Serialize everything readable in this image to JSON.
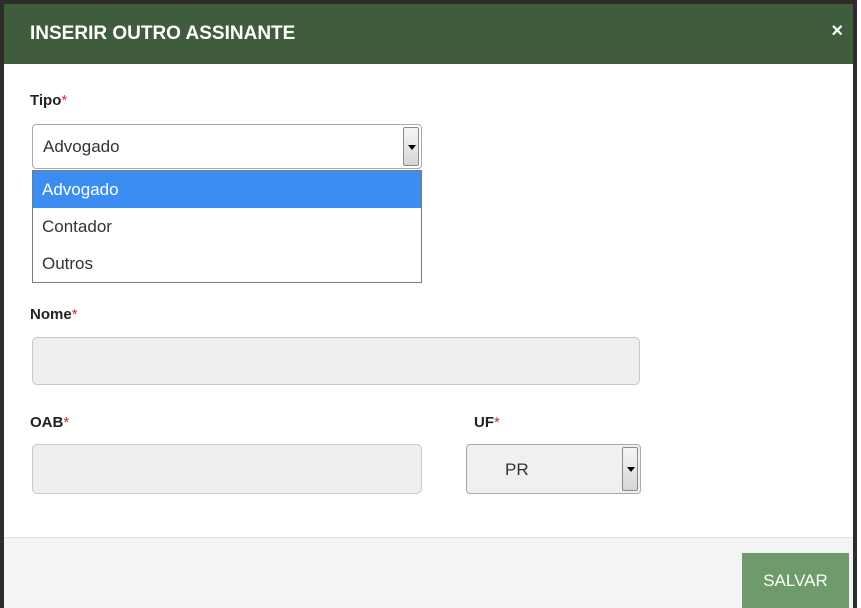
{
  "dialog": {
    "title": "INSERIR OUTRO ASSINANTE",
    "close_icon": "×"
  },
  "fields": {
    "tipo": {
      "label": "Tipo",
      "required": "*",
      "selected": "Advogado",
      "options": [
        "Advogado",
        "Contador",
        "Outros"
      ]
    },
    "nome": {
      "label": "Nome",
      "required": "*",
      "value": ""
    },
    "oab": {
      "label": "OAB",
      "required": "*",
      "value": ""
    },
    "uf": {
      "label": "UF",
      "required": "*",
      "selected": "PR"
    }
  },
  "footer": {
    "save_label": "SALVAR"
  },
  "colors": {
    "header_bg": "#3f5d3c",
    "selected_option": "#3b8df2",
    "save_button": "#6e9a6c",
    "required_mark": "#cc2b2b"
  }
}
